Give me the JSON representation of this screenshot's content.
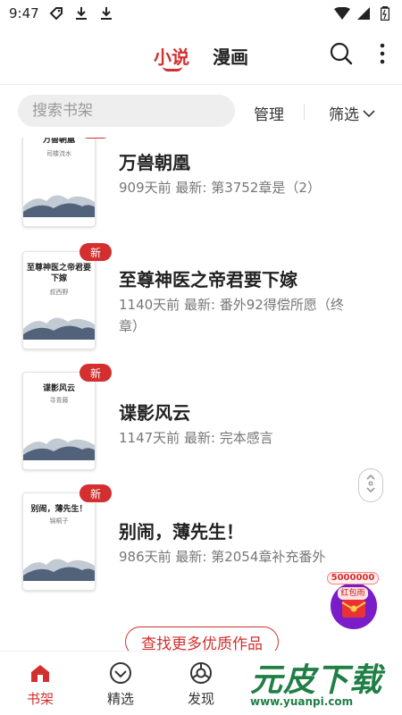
{
  "status_bar": {
    "time": "9:47"
  },
  "header": {
    "tabs": [
      {
        "label": "小说",
        "active": true
      },
      {
        "label": "漫画",
        "active": false
      }
    ]
  },
  "search": {
    "placeholder": "搜索书架"
  },
  "toolbar": {
    "manage_label": "管理",
    "filter_label": "筛选"
  },
  "books": [
    {
      "title": "万兽朝凰",
      "meta": "909天前 最新: 第3752章是（2）",
      "cover_title": "万兽朝凰",
      "cover_author": "司楼流水",
      "badge": "新"
    },
    {
      "title": "至尊神医之帝君要下嫁",
      "meta": "1140天前 最新: 番外92得偿所愿（终章）",
      "cover_title": "至尊神医之帝君要下嫁",
      "cover_author": "叔西野",
      "badge": "新"
    },
    {
      "title": "谍影风云",
      "meta": "1147天前 最新: 完本感言",
      "cover_title": "谍影风云",
      "cover_author": "寻青藤",
      "badge": "新"
    },
    {
      "title": "别闹，薄先生！",
      "meta": "986天前 最新: 第2054章补充番外",
      "cover_title": "别闹，薄先生！",
      "cover_author": "锦桐子",
      "badge": "新"
    }
  ],
  "redpacket": {
    "amount": "5000000",
    "label": "红包雨"
  },
  "more_button": {
    "label": "查找更多优质作品"
  },
  "bottom_nav": [
    {
      "label": "书架",
      "active": true
    },
    {
      "label": "精选",
      "active": false
    },
    {
      "label": "发现",
      "active": false
    }
  ],
  "watermark": {
    "text": "元皮下载",
    "url": "www.yuanpi.com"
  },
  "colors": {
    "accent": "#d32f2f",
    "watermark": "#1f7f45"
  }
}
